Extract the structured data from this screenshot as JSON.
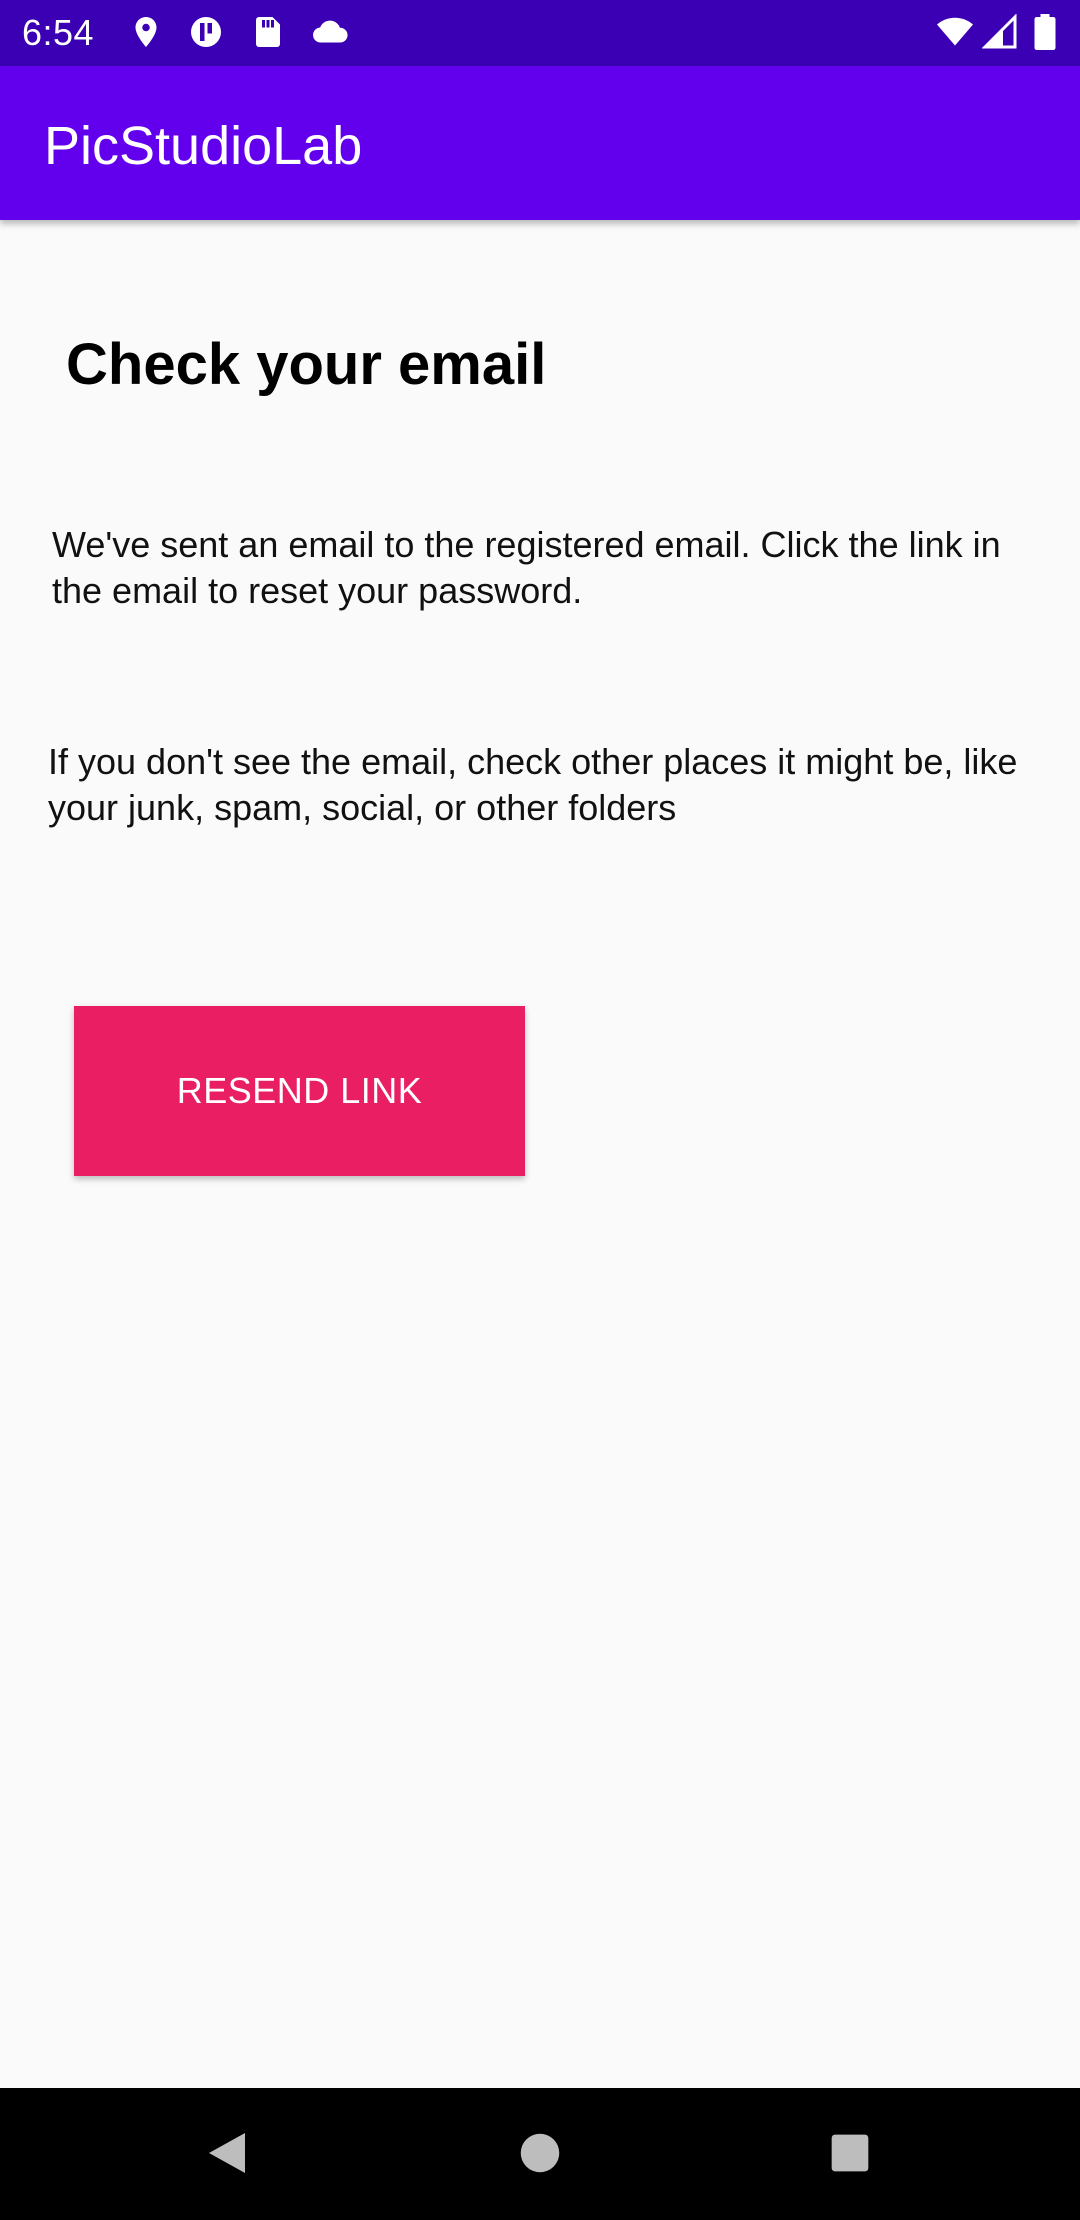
{
  "status_bar": {
    "time": "6:54",
    "icons_left": [
      "location-icon",
      "app-notification-icon",
      "sd-card-icon",
      "cloud-icon"
    ],
    "icons_right": [
      "wifi-icon",
      "signal-icon",
      "battery-icon"
    ]
  },
  "app_bar": {
    "title": "PicStudioLab",
    "color": "#6200ee"
  },
  "content": {
    "heading": "Check your email",
    "message": "We've sent an email to the registered email. Click the link in the email to reset your password.",
    "hint": "If you don't see the email, check other places it might be, like your junk, spam, social, or other folders",
    "resend_button": "RESEND LINK",
    "button_color": "#e91e63"
  },
  "nav_bar": {
    "buttons": [
      "back-icon",
      "home-icon",
      "recents-icon"
    ]
  }
}
